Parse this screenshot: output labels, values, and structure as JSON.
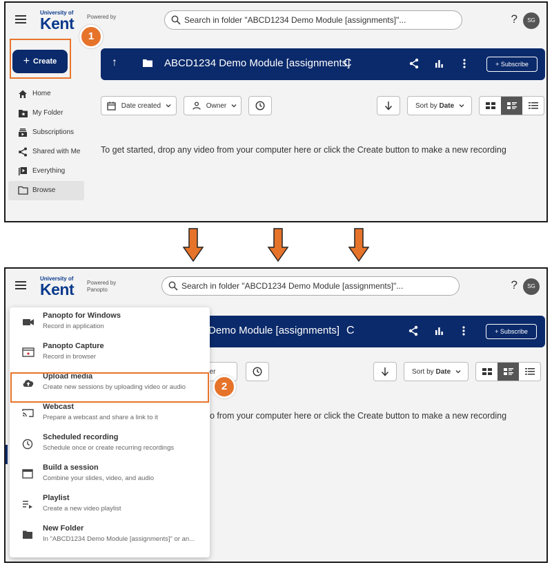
{
  "brand": {
    "university": "University of",
    "name": "Kent",
    "powered_by": "Powered by",
    "panopto": "Panopto"
  },
  "search": {
    "placeholder": "Search in folder \"ABCD1234 Demo Module [assignments]\"..."
  },
  "user": {
    "help": "?",
    "initials": "SG"
  },
  "create": {
    "plus": "+",
    "label": "Create"
  },
  "badges": {
    "one": "1",
    "two": "2"
  },
  "nav": [
    {
      "label": "Home",
      "icon": "home-icon"
    },
    {
      "label": "My Folder",
      "icon": "star-folder-icon"
    },
    {
      "label": "Subscriptions",
      "icon": "subscriptions-icon"
    },
    {
      "label": "Shared with Me",
      "icon": "share-icon"
    },
    {
      "label": "Everything",
      "icon": "play-list-icon"
    },
    {
      "label": "Browse",
      "icon": "folder-icon",
      "active": true
    }
  ],
  "header": {
    "up": "↑",
    "title": "ABCD1234 Demo Module [assignments]",
    "title_partial": "Demo Module [assignments]",
    "refresh": "C",
    "subscribe": "+ Subscribe"
  },
  "filters": {
    "date_created": "Date created",
    "owner": "Owner",
    "owner_partial": "vner",
    "sort_prefix": "Sort by",
    "sort_value": "Date"
  },
  "empty": {
    "message": "To get started, drop any video from your computer here or click the Create button to make a new recording",
    "message_partial": "o from your computer here or click the Create button to make a new recording"
  },
  "menu": [
    {
      "title": "Panopto for Windows",
      "subtitle": "Record in application",
      "icon": "camera-icon"
    },
    {
      "title": "Panopto Capture",
      "subtitle": "Record in browser",
      "icon": "browser-record-icon"
    },
    {
      "title": "Upload media",
      "subtitle": "Create new sessions by uploading video or audio",
      "icon": "cloud-upload-icon"
    },
    {
      "title": "Webcast",
      "subtitle": "Prepare a webcast and share a link to it",
      "icon": "cast-icon"
    },
    {
      "title": "Scheduled recording",
      "subtitle": "Schedule once or create recurring recordings",
      "icon": "clock-icon"
    },
    {
      "title": "Build a session",
      "subtitle": "Combine your slides, video, and audio",
      "icon": "window-icon"
    },
    {
      "title": "Playlist",
      "subtitle": "Create a new video playlist",
      "icon": "playlist-icon"
    },
    {
      "title": "New Folder",
      "subtitle": "In \"ABCD1234 Demo Module [assignments]\" or an...",
      "icon": "folder-icon"
    }
  ],
  "colors": {
    "navy": "#0b2a6b",
    "orange": "#e6732a",
    "panel_bg": "#f3f3f3"
  }
}
